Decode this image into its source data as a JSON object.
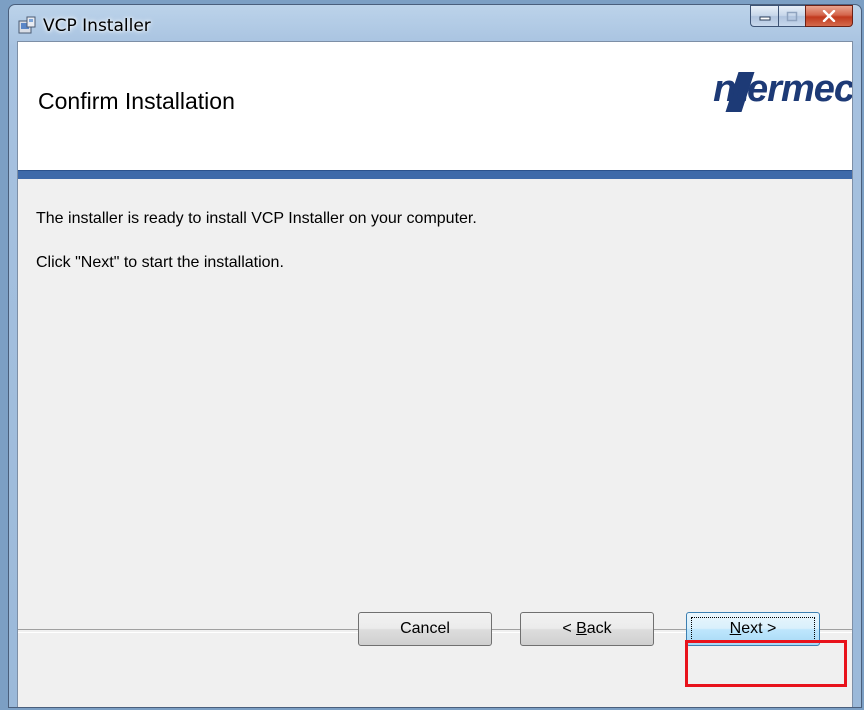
{
  "window": {
    "title": "VCP Installer",
    "icons": [
      "installer-icon",
      "minimize-icon",
      "maximize-icon",
      "close-icon"
    ]
  },
  "banner": {
    "title": "Confirm Installation",
    "logo_text": "ntermec"
  },
  "body": {
    "line1": "The installer is ready to install VCP Installer on your computer.",
    "line2": "Click \"Next\" to start the installation."
  },
  "buttons": {
    "cancel": "Cancel",
    "back_prefix": "< ",
    "back_mnemonic": "B",
    "back_rest": "ack",
    "next_mnemonic": "N",
    "next_rest": "ext >"
  },
  "colors": {
    "banner_band": "#3e6aa9",
    "logo": "#1d3a76",
    "highlight": "#e8121b"
  }
}
